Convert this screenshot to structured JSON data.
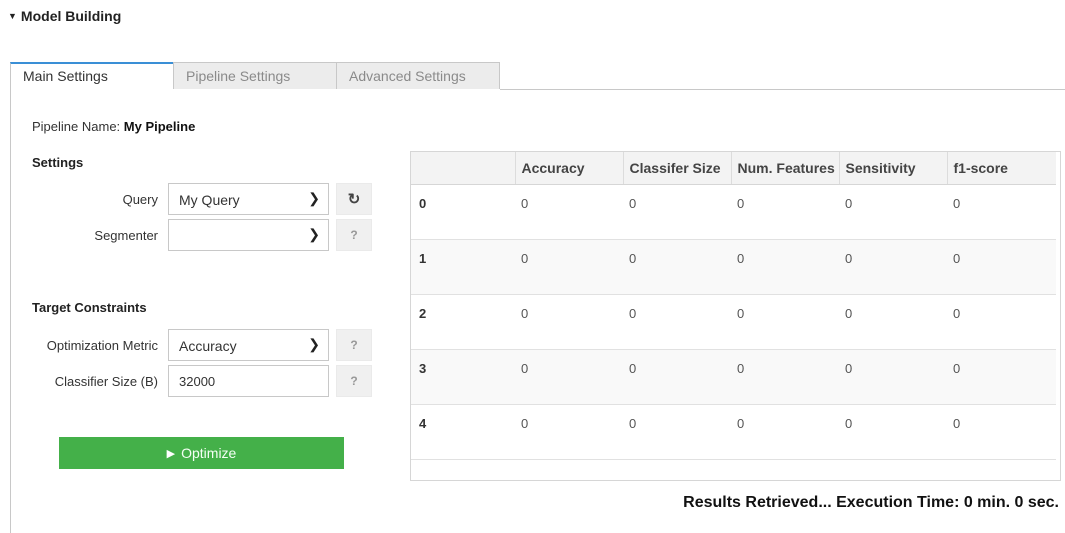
{
  "section": {
    "title": "Model Building"
  },
  "tabs": [
    {
      "label": "Main Settings",
      "active": true
    },
    {
      "label": "Pipeline Settings",
      "active": false
    },
    {
      "label": "Advanced Settings",
      "active": false
    }
  ],
  "pipeline": {
    "name_label": "Pipeline Name: ",
    "name_value": "My Pipeline"
  },
  "settings": {
    "title": "Settings",
    "query": {
      "label": "Query",
      "value": "My Query"
    },
    "segmenter": {
      "label": "Segmenter",
      "value": "",
      "help": "?"
    }
  },
  "constraints": {
    "title": "Target Constraints",
    "metric": {
      "label": "Optimization Metric",
      "value": "Accuracy",
      "help": "?"
    },
    "classifier_size": {
      "label": "Classifier Size (B)",
      "value": "32000",
      "help": "?"
    }
  },
  "optimize": {
    "label": "Optimize",
    "color": "#44b049"
  },
  "results_table": {
    "columns": [
      "",
      "Accuracy",
      "Classifer Size",
      "Num. Features",
      "Sensitivity",
      "f1-score"
    ],
    "rows": [
      [
        "0",
        "0",
        "0",
        "0",
        "0",
        "0"
      ],
      [
        "1",
        "0",
        "0",
        "0",
        "0",
        "0"
      ],
      [
        "2",
        "0",
        "0",
        "0",
        "0",
        "0"
      ],
      [
        "3",
        "0",
        "0",
        "0",
        "0",
        "0"
      ],
      [
        "4",
        "0",
        "0",
        "0",
        "0",
        "0"
      ]
    ]
  },
  "status": {
    "text": "Results Retrieved... Execution Time: 0 min. 0 sec."
  },
  "colors": {
    "accent": "#3a8fd6",
    "button_green": "#44b049"
  }
}
